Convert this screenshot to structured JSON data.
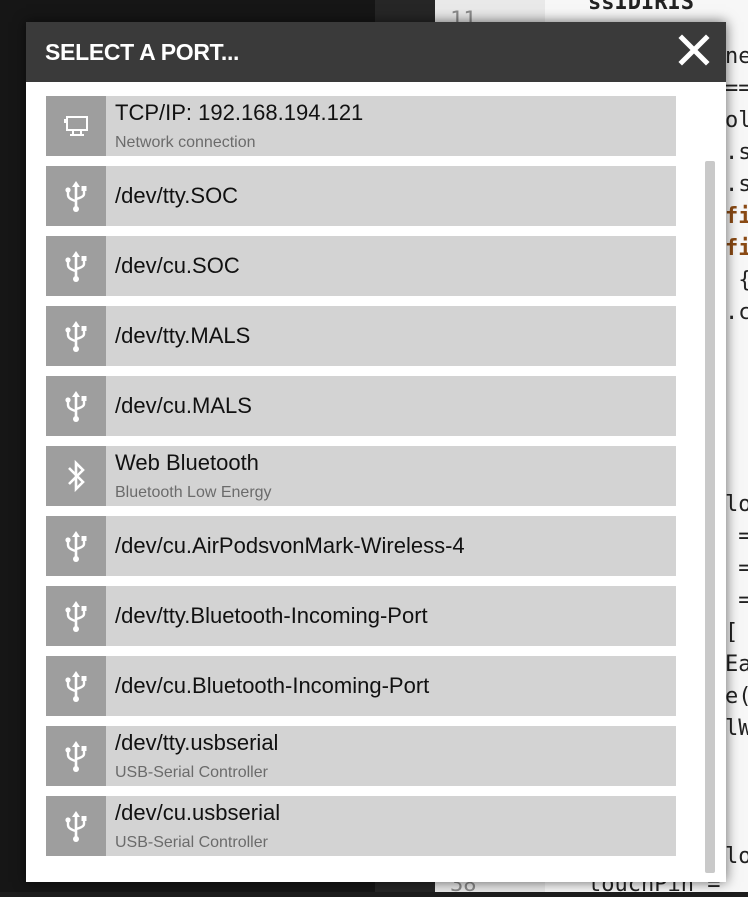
{
  "background_editor": {
    "line_numbers": [
      "11",
      "38"
    ],
    "code_fragments": [
      "ne",
      "==",
      "ol",
      ".s",
      ".s",
      "fi",
      "fi",
      " {",
      ".c",
      "lo",
      " =",
      " =",
      " =",
      "[",
      "Ea",
      "e(",
      "lW",
      "lo"
    ],
    "code_bottom": "touchPin =",
    "code_top": "ssIDIRIS"
  },
  "modal": {
    "title": "SELECT A PORT...",
    "close_icon": "close-icon"
  },
  "ports": [
    {
      "icon": "network-icon",
      "name": "TCP/IP: 192.168.194.121",
      "description": "Network connection"
    },
    {
      "icon": "usb-icon",
      "name": "/dev/tty.SOC",
      "description": ""
    },
    {
      "icon": "usb-icon",
      "name": "/dev/cu.SOC",
      "description": ""
    },
    {
      "icon": "usb-icon",
      "name": "/dev/tty.MALS",
      "description": ""
    },
    {
      "icon": "usb-icon",
      "name": "/dev/cu.MALS",
      "description": ""
    },
    {
      "icon": "bluetooth-icon",
      "name": "Web Bluetooth",
      "description": "Bluetooth Low Energy"
    },
    {
      "icon": "usb-icon",
      "name": "/dev/cu.AirPodsvonMark-Wireless-4",
      "description": ""
    },
    {
      "icon": "usb-icon",
      "name": "/dev/tty.Bluetooth-Incoming-Port",
      "description": ""
    },
    {
      "icon": "usb-icon",
      "name": "/dev/cu.Bluetooth-Incoming-Port",
      "description": ""
    },
    {
      "icon": "usb-icon",
      "name": "/dev/tty.usbserial",
      "description": "USB-Serial Controller"
    },
    {
      "icon": "usb-icon",
      "name": "/dev/cu.usbserial",
      "description": "USB-Serial Controller"
    }
  ],
  "colors": {
    "header_bg": "#3a3a3a",
    "item_bg": "#d3d3d3",
    "icon_bg": "#9e9e9e"
  }
}
